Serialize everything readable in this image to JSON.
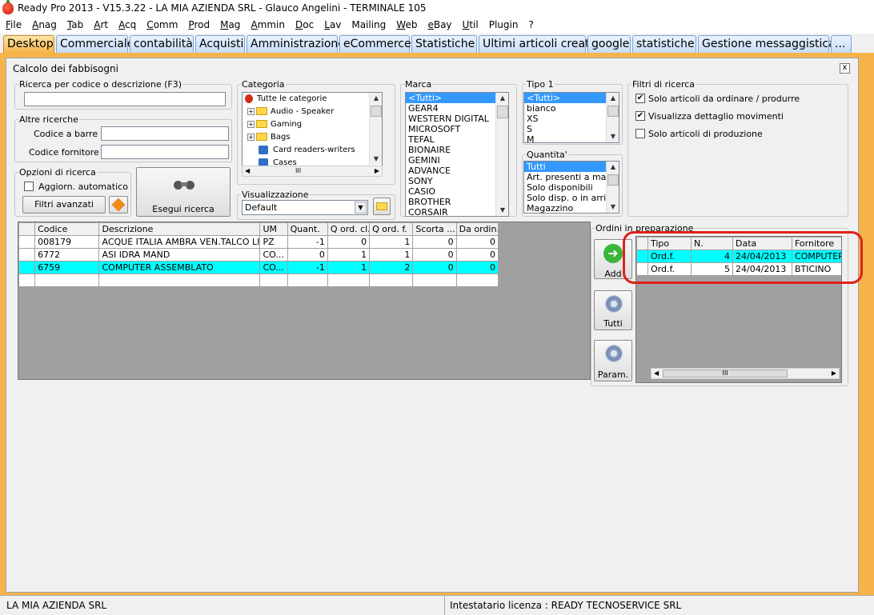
{
  "titlebar": {
    "title": "Ready Pro 2013 - V15.3.22 - LA MIA AZIENDA SRL - Glauco Angelini - TERMINALE 105"
  },
  "menu": [
    "File",
    "Anag",
    "Tab",
    "Art",
    "Acq",
    "Comm",
    "Prod",
    "Mag",
    "Ammin",
    "Doc",
    "Lav",
    "Mailing",
    "Web",
    "eBay",
    "Util",
    "Plugin",
    "?"
  ],
  "tabs": [
    "Desktop",
    "Commerciale",
    "contabilità",
    "Acquisti",
    "Amministrazione",
    "eCommerce",
    "Statistiche",
    "Ultimi articoli creati",
    "google",
    "statistiche",
    "Gestione messaggistica",
    "..."
  ],
  "window": {
    "title": "Calcolo dei fabbisogni",
    "close": "x"
  },
  "search": {
    "legend": "Ricerca per codice o descrizione (F3)",
    "value": ""
  },
  "altre": {
    "legend": "Altre ricerche",
    "barcode_label": "Codice a barre :",
    "supplier_label": "Codice fornitore :"
  },
  "opzioni": {
    "legend": "Opzioni di ricerca",
    "auto_label": "Aggiorn. automatico",
    "filters_btn": "Filtri avanzati"
  },
  "esegui": {
    "label": "Esegui ricerca"
  },
  "categoria": {
    "legend": "Categoria",
    "items": [
      "Tutte le categorie",
      "Audio - Speaker",
      "Gaming",
      "Bags",
      "Card readers-writers",
      "Cases"
    ]
  },
  "visualizzazione": {
    "legend": "Visualizzazione",
    "value": "Default"
  },
  "marca": {
    "legend": "Marca",
    "items": [
      "<Tutti>",
      "GEAR4",
      "WESTERN DIGITAL",
      "MICROSOFT",
      "TEFAL",
      "BIONAIRE",
      "GEMINI",
      "ADVANCE",
      "SONY",
      "CASIO",
      "BROTHER",
      "CORSAIR"
    ]
  },
  "tipo1": {
    "legend": "Tipo 1",
    "items": [
      "<Tutti>",
      "bianco",
      "XS",
      "S",
      "M"
    ]
  },
  "quantita": {
    "legend": "Quantita'",
    "items": [
      "Tutti",
      "Art. presenti a magazzino",
      "Solo disponibili",
      "Solo disp. o in arrivo",
      "Magazzino"
    ]
  },
  "filtri": {
    "legend": "Filtri di ricerca",
    "options": [
      {
        "label": "Solo articoli da ordinare / produrre",
        "checked": true
      },
      {
        "label": "Visualizza dettaglio movimenti",
        "checked": true
      },
      {
        "label": "Solo articoli di produzione",
        "checked": false
      }
    ]
  },
  "grid": {
    "headers": [
      "Codice",
      "Descrizione",
      "UM",
      "Quant.",
      "Q ord. cl.",
      "Q ord. f.",
      "Scorta ...",
      "Da ordin."
    ],
    "rows": [
      [
        "008179",
        "ACQUE ITALIA AMBRA VEN.TALCO LI...",
        "PZ",
        "-1",
        "0",
        "1",
        "0",
        "0"
      ],
      [
        "6772",
        "ASI IDRA MAND",
        "CO...",
        "0",
        "1",
        "1",
        "0",
        "0"
      ],
      [
        "6759",
        "COMPUTER ASSEMBLATO",
        "CO...",
        "-1",
        "1",
        "2",
        "0",
        "0"
      ]
    ]
  },
  "ordini": {
    "legend": "Ordini in preparazione",
    "add": "Add",
    "tutti": "Tutti",
    "param": "Param.",
    "headers": [
      "Tipo",
      "N.",
      "Data",
      "Fornitore"
    ],
    "rows": [
      [
        "Ord.f.",
        "4",
        "24/04/2013",
        "COMPUTER C"
      ],
      [
        "Ord.f.",
        "5",
        "24/04/2013",
        "BTICINO"
      ]
    ]
  },
  "scroll": {
    "hbar": "III"
  },
  "status": {
    "left": "LA MIA AZIENDA SRL",
    "right": "Intestatario licenza : READY TECNOSERVICE SRL"
  },
  "colors": {
    "accent": "#f6b34a",
    "selection": "#3399ff",
    "highlight_row": "#00ffff",
    "annotation": "#e0201a"
  }
}
